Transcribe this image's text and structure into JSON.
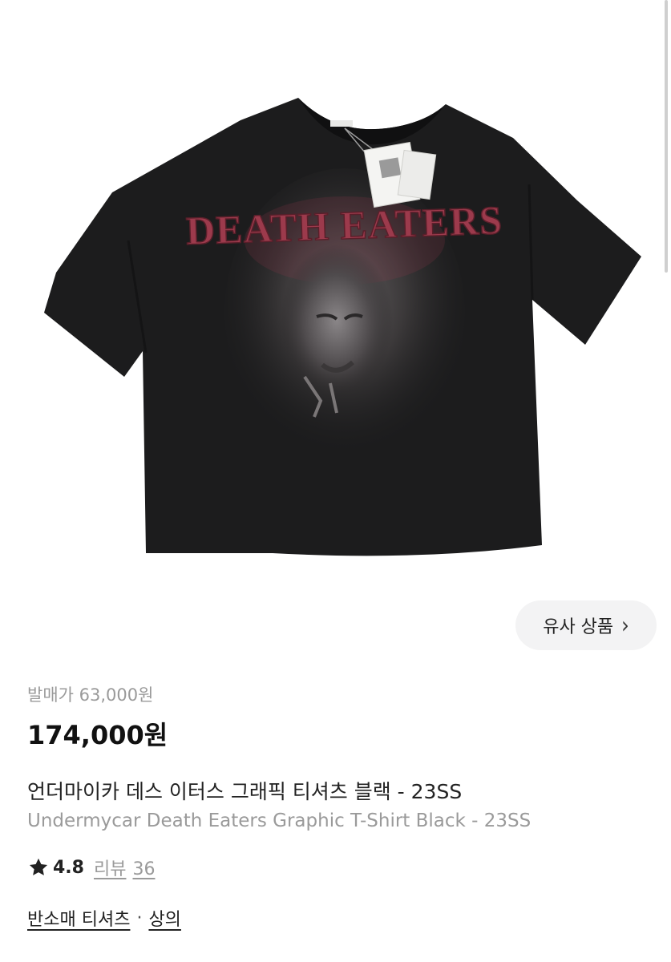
{
  "product": {
    "shirt_print_text": "DEATH EATERS",
    "similar_button_label": "유사 상품",
    "similar_button_icon": "chevron-right-icon",
    "release_price_label": "발매가 63,000원",
    "price": "174,000원",
    "title_ko": "언더마이카 데스 이터스 그래픽 티셔츠 블랙 - 23SS",
    "title_en": "Undermycar Death Eaters Graphic T-Shirt Black - 23SS",
    "rating": {
      "icon": "star-icon",
      "score": "4.8",
      "review_label": "리뷰",
      "review_count": "36"
    },
    "categories": {
      "primary": "반소매 티셔츠",
      "separator": "·",
      "secondary": "상의"
    }
  },
  "colors": {
    "shirt": "#1c1c1d",
    "print_red": "#9c3a4c",
    "muted_text": "#9a9a9a",
    "button_bg": "#f3f3f4"
  }
}
